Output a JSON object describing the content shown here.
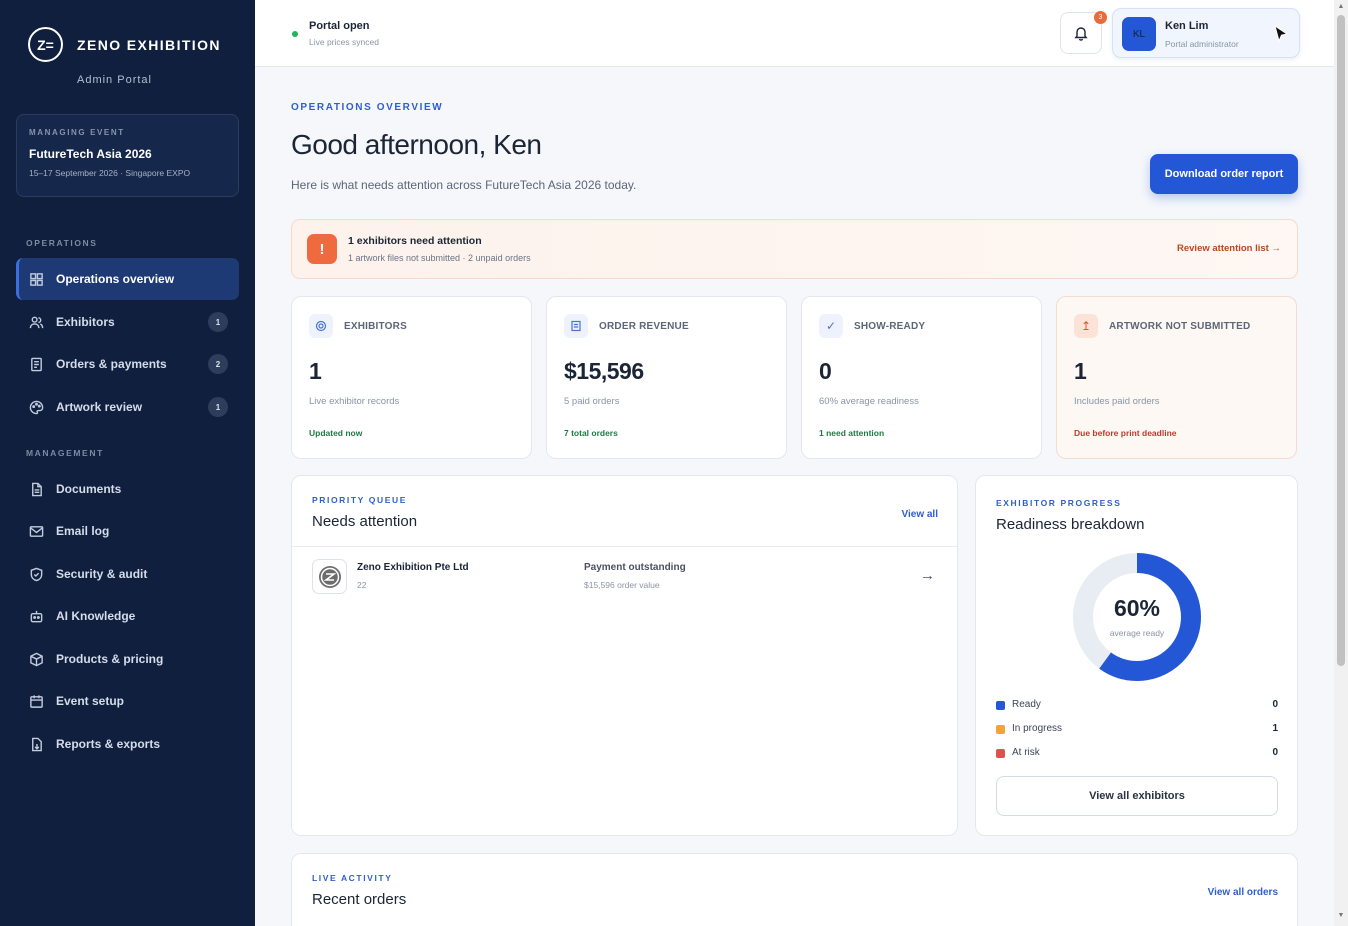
{
  "brand": {
    "name": "ZENO EXHIBITION",
    "subtitle": "Admin Portal",
    "logo_text": "Z="
  },
  "event": {
    "label": "MANAGING EVENT",
    "name": "FutureTech Asia 2026",
    "dates": "15–17 September 2026 · Singapore EXPO"
  },
  "sidebar": {
    "section_ops": "OPERATIONS",
    "section_mgmt": "MANAGEMENT",
    "ops_items": [
      {
        "label": "Operations overview",
        "badge": ""
      },
      {
        "label": "Exhibitors",
        "badge": "1"
      },
      {
        "label": "Orders & payments",
        "badge": "2"
      },
      {
        "label": "Artwork review",
        "badge": "1"
      }
    ],
    "mgmt_items": [
      {
        "label": "Documents"
      },
      {
        "label": "Email log"
      },
      {
        "label": "Security & audit"
      },
      {
        "label": "AI Knowledge"
      },
      {
        "label": "Products & pricing"
      },
      {
        "label": "Event setup"
      },
      {
        "label": "Reports & exports"
      }
    ]
  },
  "topbar": {
    "status_title": "Portal open",
    "status_sub": "Live prices synced",
    "notification_count": "3",
    "user_initials": "KL",
    "user_name": "Ken Lim",
    "user_role": "Portal administrator"
  },
  "header": {
    "eyebrow": "OPERATIONS OVERVIEW",
    "greeting": "Good afternoon, Ken",
    "subtitle": "Here is what needs attention across FutureTech Asia 2026 today.",
    "download_button": "Download order report"
  },
  "alert": {
    "title": "1 exhibitors need attention",
    "detail": "1 artwork files not submitted · 2 unpaid orders",
    "link": "Review attention list →"
  },
  "stats": [
    {
      "label": "EXHIBITORS",
      "value": "1",
      "sub": "Live exhibitor records",
      "foot": "Updated now",
      "foot_color": "#1d7a45"
    },
    {
      "label": "ORDER REVENUE",
      "value": "$15,596",
      "sub": "5 paid orders",
      "foot": "7 total orders",
      "foot_color": "#1d7a45"
    },
    {
      "label": "SHOW-READY",
      "value": "0",
      "sub": "60% average readiness",
      "foot": "1 need attention",
      "foot_color": "#1d7a45"
    },
    {
      "label": "ARTWORK NOT SUBMITTED",
      "value": "1",
      "sub": "Includes paid orders",
      "foot": "Due before print deadline",
      "foot_color": "#c0392b"
    }
  ],
  "queue": {
    "eyebrow": "PRIORITY QUEUE",
    "title": "Needs attention",
    "link": "View all",
    "rows": [
      {
        "name": "Zeno Exhibition Pte Ltd",
        "id": "22",
        "status": "Payment outstanding",
        "value": "$15,596 order value",
        "arrow": "→"
      }
    ]
  },
  "readiness": {
    "eyebrow": "EXHIBITOR PROGRESS",
    "title": "Readiness breakdown",
    "percent_label": "60%",
    "percent_value": 0.6,
    "caption": "average ready",
    "legend": [
      {
        "name": "Ready",
        "count": "0",
        "color": "#2457d6"
      },
      {
        "name": "In progress",
        "count": "1",
        "color": "#f0a43a"
      },
      {
        "name": "At risk",
        "count": "0",
        "color": "#d9534f"
      }
    ],
    "button": "View all exhibitors"
  },
  "activity": {
    "eyebrow": "LIVE ACTIVITY",
    "title": "Recent orders",
    "link": "View all orders"
  }
}
